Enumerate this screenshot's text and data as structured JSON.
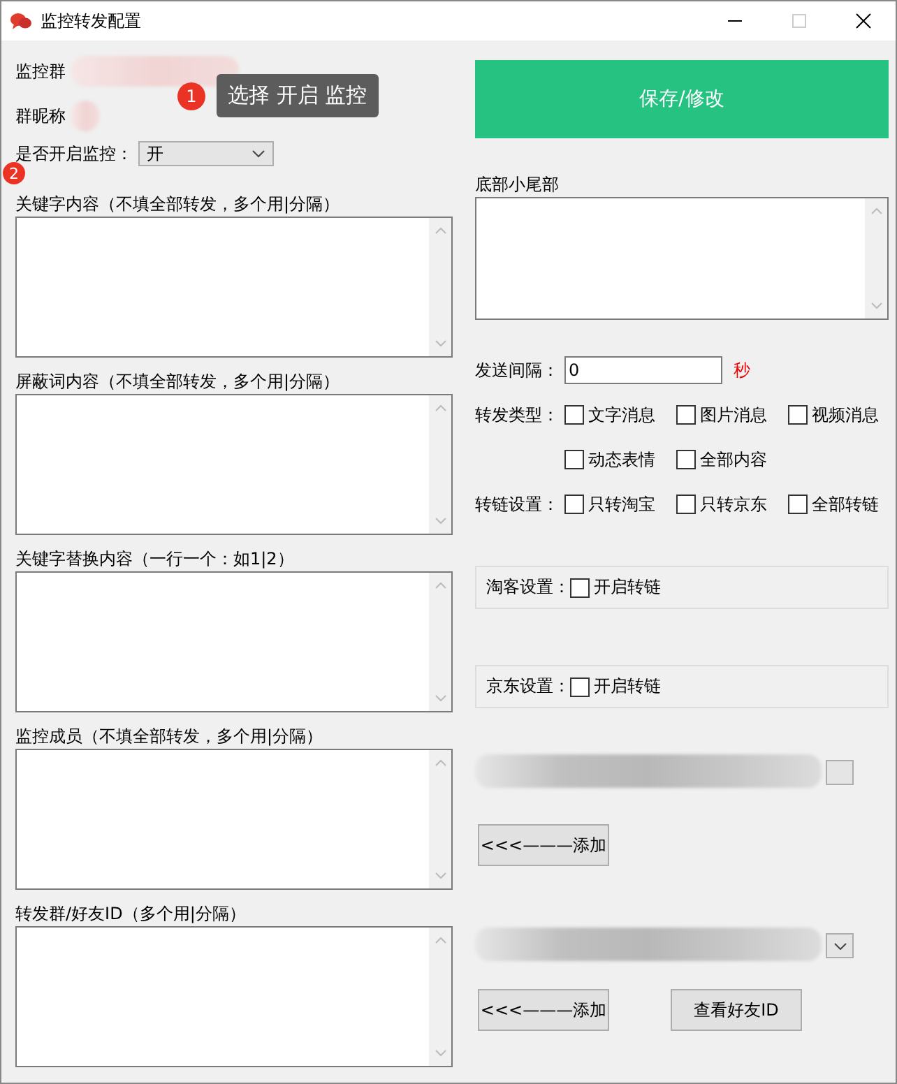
{
  "window": {
    "title": "监控转发配置"
  },
  "monitor_group": {
    "label": "监控群"
  },
  "nickname": {
    "label": "群昵称"
  },
  "enable_monitor": {
    "label": "是否开启监控：",
    "value": "开"
  },
  "hints": [
    {
      "badge": "1",
      "text": "选择 开启 监控"
    },
    {
      "badge": "2"
    }
  ],
  "save_button": "保存/修改",
  "left_fields": [
    {
      "label": "关键字内容（不填全部转发，多个用|分隔）"
    },
    {
      "label": "屏蔽词内容（不填全部转发，多个用|分隔）"
    },
    {
      "label": "关键字替换内容（一行一个：如1|2）"
    },
    {
      "label": "监控成员（不填全部转发，多个用|分隔）"
    },
    {
      "label": "转发群/好友ID（多个用|分隔）"
    }
  ],
  "footer_field": {
    "label": "底部小尾部"
  },
  "send_interval": {
    "label": "发送间隔：",
    "value": "0",
    "unit": "秒"
  },
  "checkbox_rows": [
    {
      "label": "转发类型：",
      "options": [
        {
          "label": "文字消息",
          "checked": false
        },
        {
          "label": "图片消息",
          "checked": false
        },
        {
          "label": "视频消息",
          "checked": false
        }
      ]
    },
    {
      "options": [
        {
          "label": "动态表情",
          "checked": false
        },
        {
          "label": "全部内容",
          "checked": false
        }
      ]
    },
    {
      "label": "转链设置：",
      "options": [
        {
          "label": "只转淘宝",
          "checked": false
        },
        {
          "label": "只转京东",
          "checked": false
        },
        {
          "label": "全部转链",
          "checked": false
        }
      ]
    }
  ],
  "group_boxes": [
    {
      "label": "淘客设置：",
      "option": {
        "label": "开启转链",
        "checked": false
      }
    },
    {
      "label": "京东设置：",
      "option": {
        "label": "开启转链",
        "checked": false
      }
    }
  ],
  "member_add_button": "<<<———添加",
  "friend_buttons": [
    "<<<———添加",
    "查看好友ID"
  ]
}
